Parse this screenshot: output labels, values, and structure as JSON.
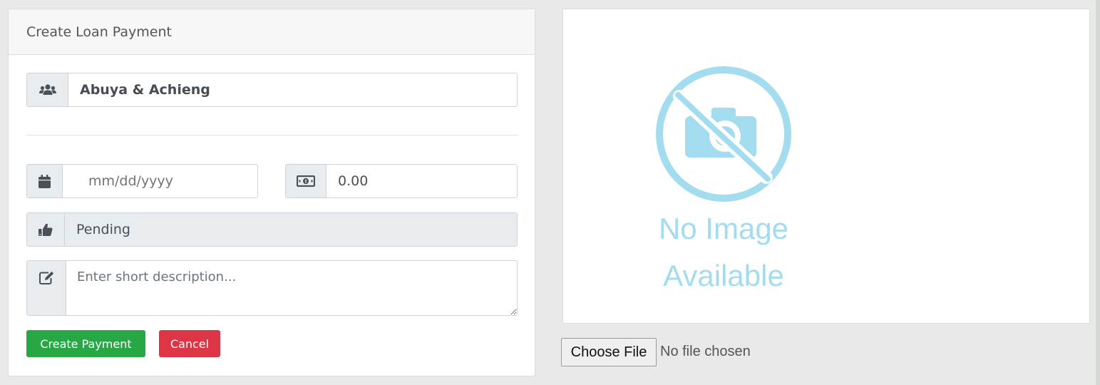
{
  "card": {
    "title": "Create Loan Payment"
  },
  "borrower": {
    "value": "Abuya & Achieng",
    "icon": "users-icon"
  },
  "date": {
    "placeholder": "mm/dd/yyyy",
    "icon": "calendar-icon"
  },
  "amount": {
    "value": "0.00",
    "icon": "money-bill-icon"
  },
  "status": {
    "value": "Pending",
    "icon": "thumbs-up-icon"
  },
  "description": {
    "placeholder": "Enter short description...",
    "icon": "edit-icon"
  },
  "buttons": {
    "create": "Create Payment",
    "cancel": "Cancel"
  },
  "image_panel": {
    "line1": "No Image",
    "line2": "Available"
  },
  "file_input": {
    "button": "Choose File",
    "status": "No file chosen"
  },
  "colors": {
    "success": "#28a745",
    "danger": "#dc3545",
    "placeholder_image": "#a3dcee"
  }
}
